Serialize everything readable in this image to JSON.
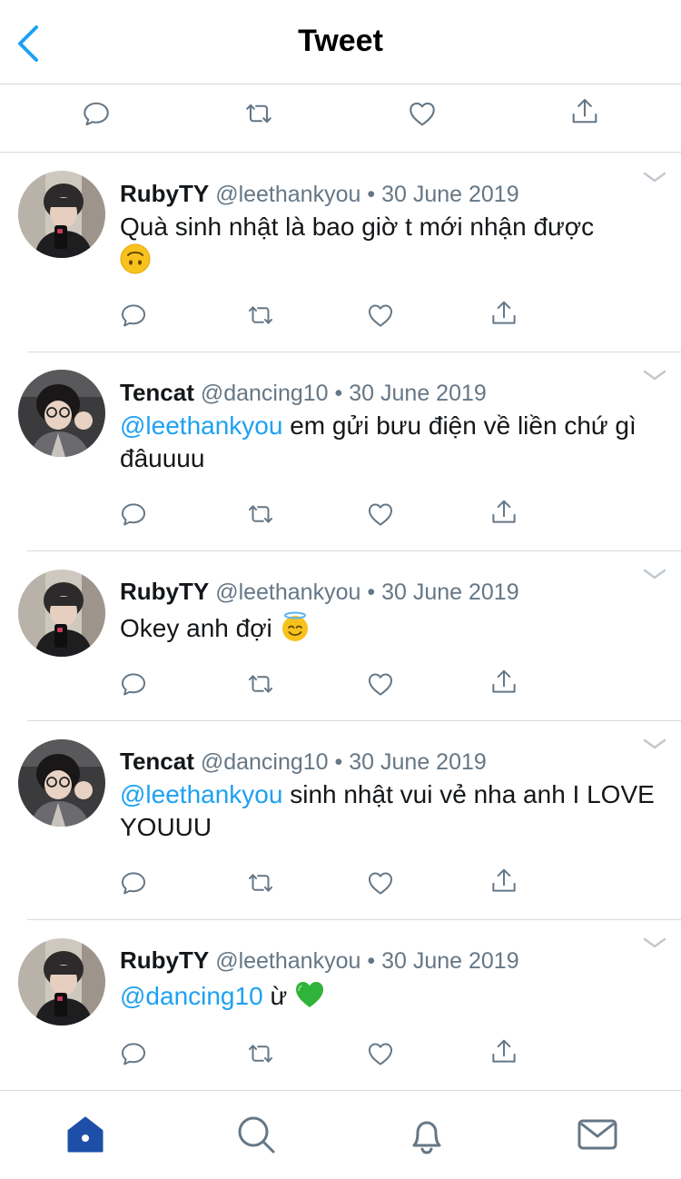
{
  "header": {
    "title": "Tweet",
    "back_icon": "chevron-left-icon"
  },
  "colors": {
    "accent": "#1da1f2",
    "text": "#14171a",
    "muted": "#657786",
    "divider": "#d5dbe0",
    "icon": "#657786",
    "home_active": "#1d4fa8"
  },
  "main_actions": [
    {
      "icon": "reply-icon"
    },
    {
      "icon": "retweet-icon"
    },
    {
      "icon": "like-icon"
    },
    {
      "icon": "share-icon"
    }
  ],
  "tweets": [
    {
      "name": "RubyTY",
      "handle": "@leethankyou",
      "separator": "•",
      "date": "30 June 2019",
      "mention": "",
      "text": "Quà sinh nhật là bao giờ t mới nhận được",
      "emoji": "upside-down-face-emoji"
    },
    {
      "name": "Tencat",
      "handle": "@dancing10",
      "separator": "•",
      "date": "30 June 2019",
      "mention": "@leethankyou",
      "text": "em gửi bưu điện về liền chứ gì đâuuuu",
      "emoji": ""
    },
    {
      "name": "RubyTY",
      "handle": "@leethankyou",
      "separator": "•",
      "date": "30 June 2019",
      "mention": "",
      "text": "Okey anh đợi",
      "emoji": "halo-face-emoji"
    },
    {
      "name": "Tencat",
      "handle": "@dancing10",
      "separator": "•",
      "date": "30 June 2019",
      "mention": "@leethankyou",
      "text": "sinh nhật vui vẻ nha anh I LOVE YOUUU",
      "emoji": ""
    },
    {
      "name": "RubyTY",
      "handle": "@leethankyou",
      "separator": "•",
      "date": "30 June 2019",
      "mention": "@dancing10",
      "text": "ừ",
      "emoji": "green-heart-emoji"
    }
  ],
  "tabbar": [
    {
      "icon": "home-icon",
      "active": true
    },
    {
      "icon": "search-icon",
      "active": false
    },
    {
      "icon": "notifications-icon",
      "active": false
    },
    {
      "icon": "messages-icon",
      "active": false
    }
  ]
}
